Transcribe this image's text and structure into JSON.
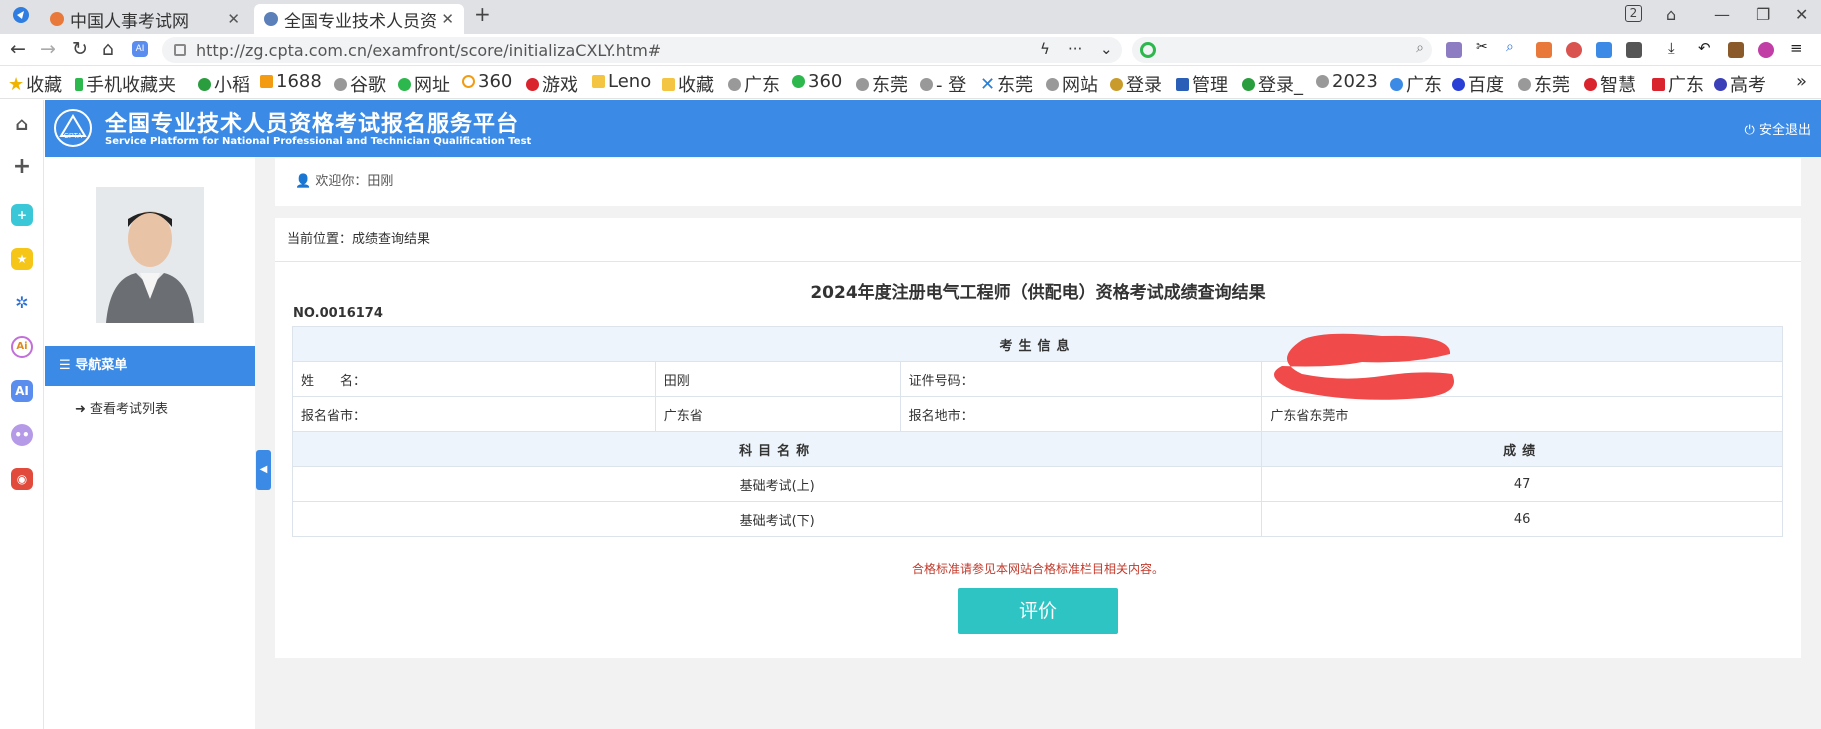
{
  "browser": {
    "tabs": [
      {
        "title": "中国人事考试网",
        "active": false
      },
      {
        "title": "全国专业技术人员资",
        "active": true
      }
    ],
    "url": "http://zg.cpta.com.cn/examfront/score/initializaCXLY.htm#",
    "window_badge": "2",
    "bookmarks": [
      "收藏",
      "手机收藏夹",
      "小稻",
      "1688",
      "谷歌",
      "网址",
      "360",
      "游戏",
      "Leno",
      "收藏",
      "广东",
      "360",
      "东莞",
      "- 登",
      "东莞",
      "网站",
      "登录",
      "管理",
      "登录_",
      "2023",
      "广东",
      "百度",
      "东莞",
      "智慧",
      "广东",
      "高考"
    ]
  },
  "site": {
    "title": "全国专业技术人员资格考试报名服务平台",
    "subtitle": "Service Platform for National Professional and Technician Qualification Test",
    "logo_text": "CPTA",
    "logout": "安全退出"
  },
  "sidebar": {
    "menu_title": "导航菜单",
    "items": [
      "查看考试列表"
    ]
  },
  "welcome": "欢迎你：田刚",
  "breadcrumb": "当前位置：成绩查询结果",
  "result": {
    "title": "2024年度注册电气工程师（供配电）资格考试成绩查询结果",
    "number": "NO.0016174",
    "section_header": "考生信息",
    "name_label": "姓　　名：",
    "name_value": "田刚",
    "id_label": "证件号码：",
    "province_label": "报名省市：",
    "province_value": "广东省",
    "city_label": "报名地市：",
    "city_value": "广东省东莞市",
    "subject_header": "科目名称",
    "score_header": "成绩",
    "subjects": [
      {
        "name": "基础考试(上)",
        "score": "47"
      },
      {
        "name": "基础考试(下)",
        "score": "46"
      }
    ]
  },
  "notice": "合格标准请参见本网站合格标准栏目相关内容。",
  "eval_button": "评价",
  "colors": {
    "brand": "#3b8be6",
    "button": "#2ec4c4",
    "notice": "#c0392b"
  }
}
